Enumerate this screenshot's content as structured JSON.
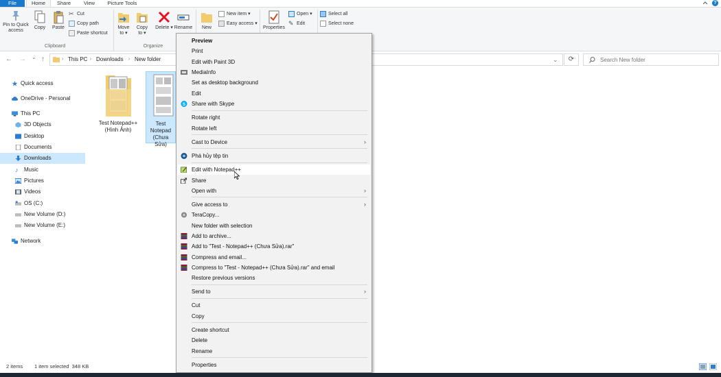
{
  "ribbon_tabs": [
    "File",
    "Home",
    "Share",
    "View",
    "Picture Tools"
  ],
  "help_label": "?",
  "clipboard": {
    "pin_label": "Pin to Quick access",
    "copy_label": "Copy",
    "paste_label": "Paste",
    "cut_label": "Cut",
    "copy_path_label": "Copy path",
    "paste_shortcut_label": "Paste shortcut",
    "group_label": "Clipboard"
  },
  "organize": {
    "move_to_label": "Move to ▾",
    "copy_to_label": "Copy to ▾",
    "delete_label": "Delete ▾",
    "rename_label": "Rename",
    "group_label": "Organize"
  },
  "new_group": {
    "new_folder_label": "New",
    "new_item_label": "New item ▾",
    "easy_access_label": "Easy access ▾"
  },
  "open_group": {
    "properties_label": "Properties",
    "open_label": "Open ▾",
    "edit_label": "Edit"
  },
  "select_group": {
    "select_all_label": "Select all",
    "select_none_label": "Select none"
  },
  "nav": {
    "back": "←",
    "forward": "→",
    "recent": "⌄",
    "up": "↑"
  },
  "breadcrumbs": [
    "This PC",
    "Downloads",
    "New folder"
  ],
  "crumb_separator": "›",
  "address_dropdown": "⌄",
  "refresh_glyph": "⟳",
  "search_placeholder": "Search New folder",
  "sidebar": {
    "items": [
      {
        "label": "Quick access"
      },
      {
        "label": "OneDrive - Personal"
      },
      {
        "label": "This PC"
      },
      {
        "label": "3D Objects"
      },
      {
        "label": "Desktop"
      },
      {
        "label": "Documents"
      },
      {
        "label": "Downloads"
      },
      {
        "label": "Music"
      },
      {
        "label": "Pictures"
      },
      {
        "label": "Videos"
      },
      {
        "label": "OS (C:)"
      },
      {
        "label": "New Volume (D:)"
      },
      {
        "label": "New Volume (E:)"
      },
      {
        "label": "Network"
      }
    ]
  },
  "files": [
    {
      "line1": "Test Notepad++",
      "line2": "(Hình Ảnh)"
    },
    {
      "line1": "Test",
      "line2": "Notepad",
      "line3": "(Chưa Sửa)"
    }
  ],
  "context_menu": {
    "items": [
      {
        "label": "Preview"
      },
      {
        "label": "Print"
      },
      {
        "label": "Edit with Paint 3D"
      },
      {
        "label": "MediaInfo"
      },
      {
        "label": "Set as desktop background"
      },
      {
        "label": "Edit"
      },
      {
        "label": "Share with Skype"
      },
      {
        "label": "Rotate right"
      },
      {
        "label": "Rotate left"
      },
      {
        "label": "Cast to Device"
      },
      {
        "label": "Phá hủy tệp tin"
      },
      {
        "label": "Edit with Notepad++"
      },
      {
        "label": "Share"
      },
      {
        "label": "Open with"
      },
      {
        "label": "Give access to"
      },
      {
        "label": "TeraCopy..."
      },
      {
        "label": "New folder with selection"
      },
      {
        "label": "Add to archive..."
      },
      {
        "label": "Add to \"Test - Notepad++ (Chưa Sửa).rar\""
      },
      {
        "label": "Compress and email..."
      },
      {
        "label": "Compress to \"Test - Notepad++ (Chưa Sửa).rar\" and email"
      },
      {
        "label": "Restore previous versions"
      },
      {
        "label": "Send to"
      },
      {
        "label": "Cut"
      },
      {
        "label": "Copy"
      },
      {
        "label": "Create shortcut"
      },
      {
        "label": "Delete"
      },
      {
        "label": "Rename"
      },
      {
        "label": "Properties"
      }
    ],
    "submenu_arrow": "›"
  },
  "status": {
    "item_count": "2 items",
    "selection": "1 item selected  348 KB"
  },
  "colors": {
    "accent": "#1979ca",
    "selection": "#cce8ff",
    "delete_red": "#e81123"
  }
}
